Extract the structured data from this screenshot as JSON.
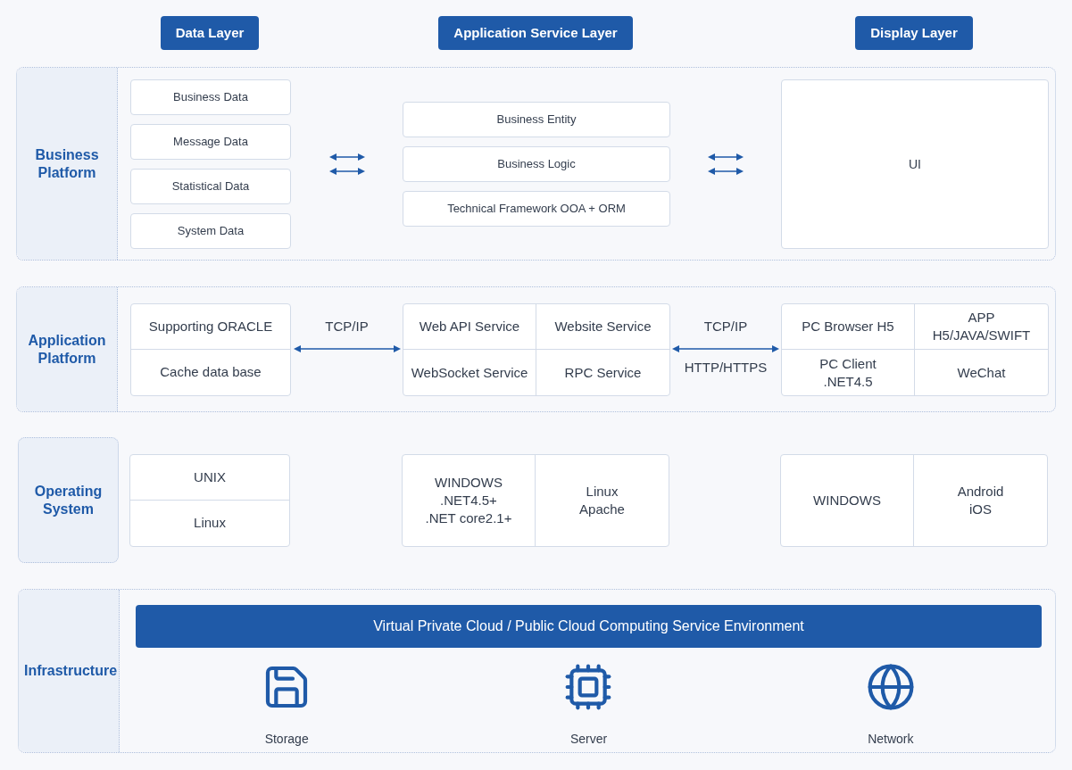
{
  "column_headers": [
    "Data Layer",
    "Application Service Layer",
    "Display Layer"
  ],
  "business_platform": {
    "label": "Business Platform",
    "data": [
      "Business Data",
      "Message Data",
      "Statistical Data",
      "System Data"
    ],
    "services": [
      "Business Entity",
      "Business Logic",
      "Technical Framework OOA + ORM"
    ],
    "display": "UI"
  },
  "application_platform": {
    "label": "Application Platform",
    "data": [
      "Supporting ORACLE",
      "Cache data base"
    ],
    "left_link": "TCP/IP",
    "services": [
      "Web API Service",
      "Website Service",
      "WebSocket Service",
      "RPC Service"
    ],
    "right_link_top": "TCP/IP",
    "right_link_bottom": "HTTP/HTTPS",
    "display": [
      "PC Browser H5",
      "APP\nH5/JAVA/SWIFT",
      "PC Client\n.NET4.5",
      "WeChat"
    ]
  },
  "operating_system": {
    "label": "Operating System",
    "data": [
      "UNIX",
      "Linux"
    ],
    "services": [
      "WINDOWS\n.NET4.5+\n.NET core2.1+",
      "Linux\nApache"
    ],
    "display": [
      "WINDOWS",
      "Android\niOS"
    ]
  },
  "infrastructure": {
    "label": "Infrastructure",
    "banner": "Virtual Private Cloud / Public Cloud Computing Service Environment",
    "items": [
      {
        "kind": "storage",
        "label": "Storage"
      },
      {
        "kind": "server",
        "label": "Server"
      },
      {
        "kind": "network",
        "label": "Network"
      }
    ]
  }
}
